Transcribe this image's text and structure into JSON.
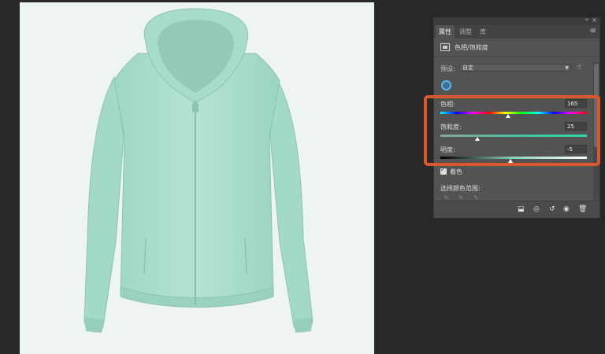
{
  "panel": {
    "collapse_icon": "«",
    "close_icon": "×",
    "tabs": [
      {
        "label": "属性",
        "active": true
      },
      {
        "label": "调整",
        "active": false
      },
      {
        "label": "库",
        "active": false
      }
    ],
    "menu_icon": "≡",
    "adjustment_title": "色相/饱和度",
    "preset_label": "预设:",
    "preset_value": "自定",
    "hue_label": "色相:",
    "hue_value": "165",
    "saturation_label": "饱和度:",
    "saturation_value": "25",
    "lightness_label": "明度:",
    "lightness_value": "-5",
    "colorize_label": "着色",
    "colorize_checked": true,
    "select_range_label": "选择颜色范围:",
    "eyedropper_icons": [
      "eyedropper-icon",
      "eyedropper-plus-icon",
      "eyedropper-minus-icon"
    ],
    "bottom_icons": [
      "clip-to-layer-icon",
      "view-previous-icon",
      "reset-icon",
      "visibility-icon",
      "delete-icon"
    ]
  },
  "sliders": {
    "hue": {
      "min": -180,
      "max": 180,
      "value": 165,
      "thumb_fraction": 0.46
    },
    "saturation": {
      "min": -100,
      "max": 100,
      "value": 25,
      "thumb_fraction": 0.25
    },
    "lightness": {
      "min": -100,
      "max": 100,
      "value": -5,
      "thumb_fraction": 0.48
    }
  },
  "colors": {
    "garment": "#a9dccb",
    "highlight": "#d9582d",
    "panel_bg": "#535353",
    "workspace_bg": "#282828",
    "canvas_bg": "#eef4f2",
    "saturation_track": "#3fc6a0"
  }
}
